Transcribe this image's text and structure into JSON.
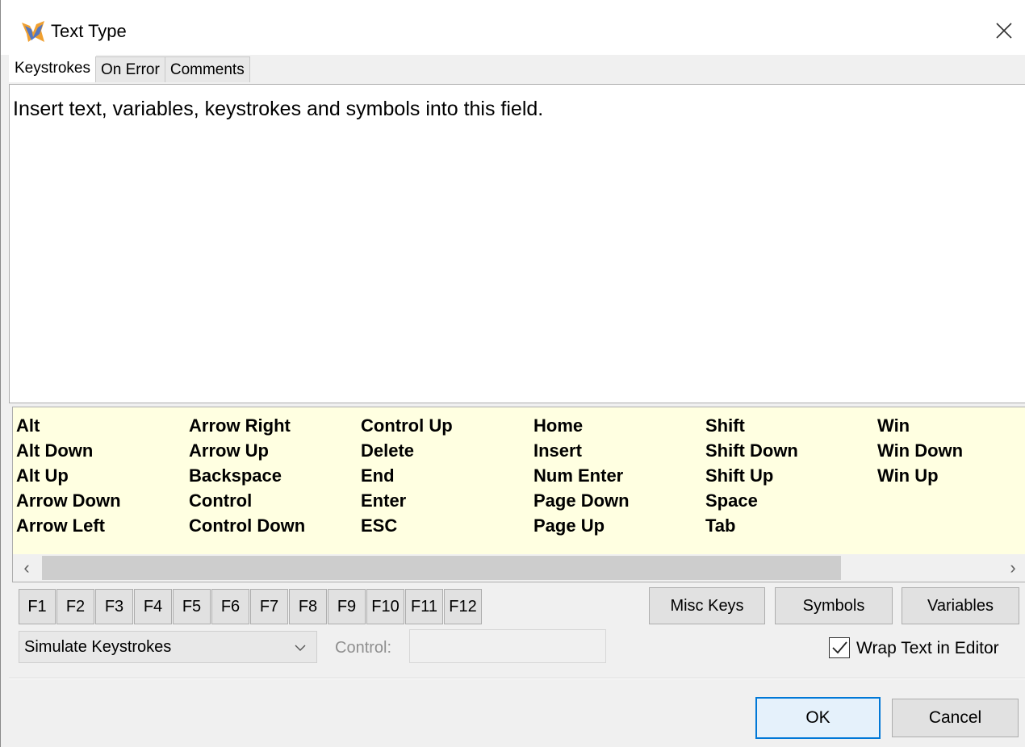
{
  "window": {
    "title": "Text Type",
    "icon": "app-icon",
    "close_icon": "close-icon"
  },
  "tabs": [
    {
      "label": "Keystrokes",
      "active": true
    },
    {
      "label": "On Error",
      "active": false
    },
    {
      "label": "Comments",
      "active": false
    }
  ],
  "editor": {
    "text": "Insert text, variables, keystrokes and symbols into this field."
  },
  "keys": [
    "Alt",
    "Alt Down",
    "Alt Up",
    "Arrow Down",
    "Arrow Left",
    "Arrow Right",
    "Arrow Up",
    "Backspace",
    "Control",
    "Control Down",
    "Control Up",
    "Delete",
    "End",
    "Enter",
    "ESC",
    "Home",
    "Insert",
    "Num Enter",
    "Page Down",
    "Page Up",
    "Shift",
    "Shift Down",
    "Shift Up",
    "Space",
    "Tab",
    "Win",
    "Win Down",
    "Win Up"
  ],
  "scrollbar": {
    "left_arrow": "‹",
    "right_arrow": "›"
  },
  "function_keys": [
    "F1",
    "F2",
    "F3",
    "F4",
    "F5",
    "F6",
    "F7",
    "F8",
    "F9",
    "F10",
    "F11",
    "F12"
  ],
  "buttons": {
    "misc_keys": "Misc Keys",
    "symbols": "Symbols",
    "variables": "Variables",
    "ok": "OK",
    "cancel": "Cancel"
  },
  "mode_select": {
    "value": "Simulate Keystrokes"
  },
  "control": {
    "label": "Control:",
    "value": ""
  },
  "wrap_text": {
    "label": "Wrap Text in Editor",
    "checked": true
  },
  "colors": {
    "keys_panel_bg": "#ffffe1",
    "ok_border": "#0078d7"
  }
}
